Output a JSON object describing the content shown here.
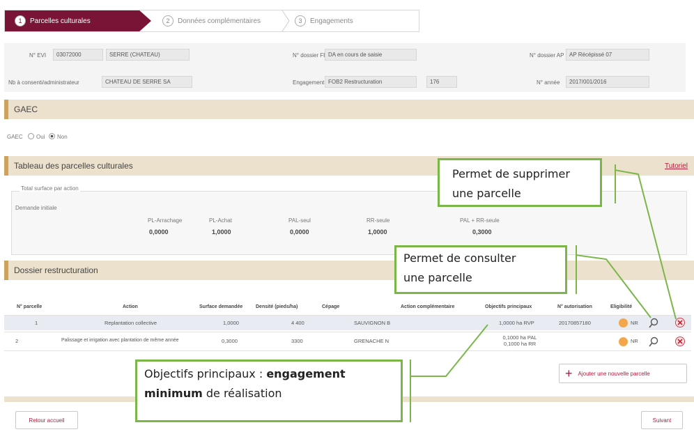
{
  "steps": [
    {
      "num": "1",
      "label": "Parcelles culturales"
    },
    {
      "num": "2",
      "label": "Données complémentaires"
    },
    {
      "num": "3",
      "label": "Engagements"
    }
  ],
  "info": {
    "num_evi_label": "N° EVI",
    "num_evi_value": "03072000",
    "name_value": "SERRE (CHATEAU)",
    "dossier_label": "N° dossier FE",
    "dossier_value": "DA en cours de saisie",
    "dossier_ap_label": "N° dossier AP",
    "dossier_ap_value": "AP Récépissé 07",
    "cons_label": "Nb à consenti/administrateur",
    "cons_value": "CHATEAU DE SERRE SA",
    "engagement_label": "Engagement",
    "engagement_value": "FOB2 Restructuration",
    "engagement_extra": "176",
    "annee_label": "N° année",
    "annee_value": "2017/001/2016"
  },
  "gaec": {
    "title": "GAEC",
    "label": "GAEC",
    "opt_yes": "Oui",
    "opt_no": "Non"
  },
  "tableau": {
    "title": "Tableau des parcelles culturales",
    "link": "Tutoriel",
    "legend": "Total surface par action",
    "demande": "Demande initiale",
    "cols": [
      "PL-Arrachage",
      "PL-Achat",
      "PAL-seul",
      "RR-seule",
      "PAL + RR-seule"
    ],
    "vals": [
      "0,0000",
      "1,0000",
      "0,0000",
      "1,0000",
      "0,3000"
    ]
  },
  "dossier": {
    "title": "Dossier restructuration"
  },
  "table": {
    "headers": [
      "N° parcelle",
      "Action",
      "Surface demandée",
      "Densité (pieds/ha)",
      "Cépage",
      "Action complémentaire",
      "Objectifs principaux",
      "N° autorisation",
      "Eligibilité"
    ],
    "rows": [
      {
        "num": "1",
        "action": "Replantation collective",
        "surface": "1,0000",
        "densite": "4 400",
        "cepage": "SAUVIGNON B",
        "objectif": "1,0000 ha RVP",
        "autorisation": "20170857180",
        "elig": "NR"
      },
      {
        "num": "2",
        "action": "Palissage et irrigation avec plantation de même année",
        "surface": "0,3000",
        "densite": "3300",
        "cepage": "GRENACHE N",
        "objectif": "0,1000 ha PAL 0,1000 ha RR",
        "autorisation": "",
        "elig": "NR"
      }
    ],
    "add_button": "Ajouter une nouvelle parcelle"
  },
  "footer": {
    "back": "Retour accueil",
    "next": "Suivant"
  },
  "callouts": {
    "supprimer": [
      "Permet de supprimer",
      "une parcelle"
    ],
    "consulter": [
      "Permet de consulter",
      "une parcelle"
    ],
    "objectifs_a": "Objectifs principaux : ",
    "objectifs_b": "engagement",
    "objectifs_c": "minimum",
    "objectifs_d": " de réalisation"
  },
  "colors": {
    "brand": "#7a1436",
    "accent": "#cfa25c",
    "callout": "#7ab648",
    "eligible": "#f4a64a"
  }
}
